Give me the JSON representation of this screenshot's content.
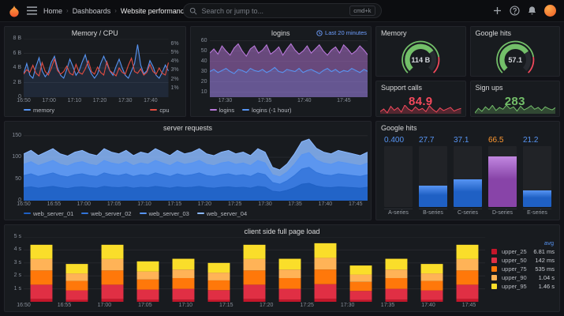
{
  "navbar": {
    "breadcrumb": [
      "Home",
      "Dashboards",
      "Website performance"
    ],
    "separator": "›",
    "search": {
      "placeholder": "Search or jump to...",
      "shortcut": "cmd+k"
    },
    "icons": {
      "logo": "grafana-flame",
      "menu": "hamburger",
      "search": "magnifier",
      "add": "plus",
      "help": "question-circle",
      "notifications": "bell",
      "profile": "user-avatar"
    }
  },
  "colors": {
    "page_bg": "#111217",
    "panel_bg": "#181b1f",
    "accent_orange": "#f05a28",
    "blue": "#5794f2",
    "red": "#f2495c",
    "green": "#73bf69",
    "purple": "#b877d9",
    "yellow": "#fade2a"
  },
  "panels": {
    "memory_cpu": {
      "title": "Memory / CPU"
    },
    "logins": {
      "title": "logins",
      "time_override": "Last 20 minutes"
    },
    "memory_gauge": {
      "title": "Memory",
      "value": "114 B",
      "fraction": 0.7,
      "color": "#73bf69",
      "threshold_color": "#f2495c",
      "threshold_frac": 0.8
    },
    "google_hits_gauge": {
      "title": "Google hits",
      "value": "57.1",
      "fraction": 0.71,
      "color": "#73bf69",
      "threshold_color": "#f2495c",
      "threshold_frac": 0.8
    },
    "support_calls": {
      "title": "Support calls",
      "value": "84.9",
      "color": "#f2495c",
      "spark": [
        60,
        70,
        55,
        80,
        65,
        75,
        58,
        85,
        70,
        62,
        78,
        66,
        72,
        60,
        82,
        68,
        58,
        74,
        64,
        70,
        76,
        62,
        68,
        72
      ]
    },
    "sign_ups": {
      "title": "Sign ups",
      "value": "283",
      "color": "#73bf69",
      "spark": [
        40,
        55,
        45,
        60,
        50,
        65,
        48,
        58,
        52,
        66,
        54,
        60,
        46,
        62,
        50,
        56,
        64,
        52,
        58,
        48,
        60,
        54,
        50,
        58
      ]
    },
    "server_requests": {
      "title": "server requests"
    },
    "google_hits_bars": {
      "title": "Google hits"
    },
    "page_load": {
      "title": "client side full page load"
    }
  },
  "chart_data": [
    {
      "id": "memory_cpu",
      "type": "line",
      "title": "Memory / CPU",
      "legend_pos": "split",
      "y_left": {
        "min": 0,
        "max": 8,
        "ticks": [
          {
            "v": 0,
            "l": "0"
          },
          {
            "v": 2,
            "l": "2 B"
          },
          {
            "v": 4,
            "l": "4 B"
          },
          {
            "v": 6,
            "l": "6 B"
          },
          {
            "v": 8,
            "l": "8 B"
          }
        ]
      },
      "y_right": {
        "min": 0,
        "max": 6.6,
        "ticks": [
          {
            "v": 1,
            "l": "1%"
          },
          {
            "v": 2,
            "l": "2%"
          },
          {
            "v": 3,
            "l": "3%"
          },
          {
            "v": 4,
            "l": "4%"
          },
          {
            "v": 5,
            "l": "5%"
          },
          {
            "v": 6,
            "l": "6%"
          }
        ]
      },
      "x_ticks": [
        {
          "f": 0,
          "l": "16:50"
        },
        {
          "f": 0.175,
          "l": "17:00"
        },
        {
          "f": 0.351,
          "l": "17:10"
        },
        {
          "f": 0.526,
          "l": "17:20"
        },
        {
          "f": 0.702,
          "l": "17:30"
        },
        {
          "f": 0.877,
          "l": "17:40"
        }
      ],
      "series": [
        {
          "name": "memory",
          "color": "#5794f2",
          "axis": "left",
          "fill": 0.12,
          "values": [
            3.2,
            4.6,
            3.0,
            2.6,
            4.2,
            5.4,
            3.6,
            2.8,
            3.4,
            4.8,
            5.6,
            4.0,
            3.0,
            2.6,
            3.8,
            5.2,
            4.2,
            3.0,
            3.6,
            4.8,
            5.8,
            4.2,
            3.2,
            2.6,
            3.2,
            4.6,
            5.6,
            4.6,
            3.6,
            3.0,
            4.2,
            5.2,
            4.0,
            3.0,
            2.6,
            3.6,
            4.6,
            7.2,
            4.4,
            3.2,
            3.6,
            5.0,
            4.2,
            3.0,
            2.6,
            3.4,
            4.4,
            3.6
          ]
        },
        {
          "name": "cpu",
          "color": "#e24d42",
          "axis": "right",
          "values": [
            2.6,
            3.1,
            2.8,
            3.6,
            2.7,
            2.4,
            3.9,
            2.9,
            2.5,
            3.3,
            4.3,
            3.0,
            2.6,
            2.9,
            3.5,
            2.7,
            2.5,
            3.7,
            2.8,
            2.6,
            3.2,
            4.1,
            2.9,
            2.6,
            3.4,
            2.8,
            2.5,
            4.0,
            3.0,
            2.7,
            2.4,
            3.3,
            2.8,
            2.6,
            3.6,
            4.4,
            2.9,
            2.7,
            3.2,
            2.5,
            2.8,
            3.7,
            2.9,
            2.6,
            3.3,
            2.7,
            2.5,
            3.9
          ]
        }
      ]
    },
    {
      "id": "logins",
      "type": "line",
      "title": "logins",
      "y_left": {
        "min": 5,
        "max": 62,
        "ticks": [
          {
            "v": 10,
            "l": "10"
          },
          {
            "v": 20,
            "l": "20"
          },
          {
            "v": 30,
            "l": "30"
          },
          {
            "v": 40,
            "l": "40"
          },
          {
            "v": 50,
            "l": "50"
          },
          {
            "v": 60,
            "l": "60"
          }
        ]
      },
      "x_ticks": [
        {
          "f": 0.1,
          "l": "17:30"
        },
        {
          "f": 0.35,
          "l": "17:35"
        },
        {
          "f": 0.6,
          "l": "17:40"
        },
        {
          "f": 0.85,
          "l": "17:45"
        }
      ],
      "series": [
        {
          "name": "logins",
          "color": "#b877d9",
          "fill": 0.5,
          "values": [
            48,
            52,
            47,
            55,
            50,
            46,
            53,
            57,
            50,
            45,
            52,
            55,
            48,
            51,
            56,
            47,
            50,
            54,
            46,
            52,
            57,
            51,
            47,
            50,
            55,
            48,
            52,
            56,
            50,
            46,
            51,
            54,
            48,
            56,
            52,
            47,
            50,
            55,
            51,
            46
          ]
        },
        {
          "name": "logins (-1 hour)",
          "color": "#5794f2",
          "fill": 0.18,
          "values": [
            30,
            32,
            29,
            31,
            33,
            30,
            28,
            32,
            31,
            29,
            33,
            31,
            30,
            32,
            29,
            31,
            34,
            30,
            29,
            32,
            31,
            30,
            33,
            29,
            31,
            32,
            30,
            28,
            31,
            33,
            30,
            32,
            29,
            31,
            30,
            33,
            31,
            29,
            32,
            30
          ]
        }
      ]
    },
    {
      "id": "server_requests",
      "type": "stacked-area",
      "title": "server requests",
      "y_left": {
        "min": 0,
        "max": 155,
        "ticks": [
          {
            "v": 0,
            "l": "0"
          },
          {
            "v": 50,
            "l": "50"
          },
          {
            "v": 100,
            "l": "100"
          },
          {
            "v": 150,
            "l": "150"
          }
        ]
      },
      "x_ticks": [
        {
          "f": 0,
          "l": "16:50"
        },
        {
          "f": 0.088,
          "l": "16:55"
        },
        {
          "f": 0.175,
          "l": "17:00"
        },
        {
          "f": 0.263,
          "l": "17:05"
        },
        {
          "f": 0.351,
          "l": "17:10"
        },
        {
          "f": 0.439,
          "l": "17:15"
        },
        {
          "f": 0.526,
          "l": "17:20"
        },
        {
          "f": 0.614,
          "l": "17:25"
        },
        {
          "f": 0.702,
          "l": "17:30"
        },
        {
          "f": 0.789,
          "l": "17:35"
        },
        {
          "f": 0.877,
          "l": "17:40"
        },
        {
          "f": 0.965,
          "l": "17:45"
        }
      ],
      "series": [
        {
          "name": "web_server_01",
          "color": "#1f60c4",
          "values": [
            30,
            32,
            29,
            31,
            33,
            30,
            28,
            31,
            32,
            30,
            29,
            33,
            31,
            30,
            32,
            29,
            31,
            30,
            33,
            31,
            29,
            32,
            30,
            31,
            33,
            30,
            29,
            31,
            32,
            30,
            31,
            29,
            33,
            31,
            22,
            20,
            24,
            30,
            38,
            40,
            34,
            31,
            30,
            32,
            31,
            30,
            29,
            31
          ]
        },
        {
          "name": "web_server_02",
          "color": "#3274d9",
          "values": [
            28,
            30,
            27,
            29,
            31,
            28,
            27,
            29,
            30,
            28,
            27,
            31,
            29,
            28,
            30,
            27,
            29,
            28,
            31,
            29,
            27,
            30,
            28,
            29,
            31,
            28,
            27,
            29,
            30,
            28,
            29,
            27,
            31,
            29,
            20,
            18,
            22,
            28,
            35,
            37,
            31,
            29,
            28,
            30,
            29,
            28,
            27,
            29
          ]
        },
        {
          "name": "web_server_03",
          "color": "#5794f2",
          "values": [
            26,
            28,
            25,
            27,
            29,
            26,
            25,
            27,
            28,
            26,
            25,
            29,
            27,
            26,
            28,
            25,
            27,
            26,
            29,
            27,
            25,
            28,
            26,
            27,
            29,
            26,
            25,
            27,
            28,
            26,
            27,
            25,
            29,
            27,
            18,
            17,
            20,
            26,
            33,
            34,
            29,
            27,
            26,
            28,
            27,
            26,
            25,
            27
          ]
        },
        {
          "name": "web_server_04",
          "color": "#8ab8ff",
          "values": [
            24,
            26,
            23,
            25,
            27,
            24,
            23,
            25,
            26,
            24,
            23,
            27,
            25,
            24,
            26,
            23,
            25,
            24,
            27,
            25,
            23,
            26,
            24,
            25,
            27,
            24,
            23,
            25,
            26,
            24,
            25,
            23,
            27,
            25,
            17,
            16,
            19,
            24,
            30,
            31,
            27,
            25,
            24,
            26,
            25,
            24,
            23,
            25
          ]
        }
      ]
    },
    {
      "id": "google_hits_bars",
      "type": "bargauge",
      "title": "Google hits",
      "max": 80,
      "bars": [
        {
          "label": "A-series",
          "value": "0.400",
          "frac": 0.006,
          "color": "#1f60c4",
          "color_top": "#5794f2",
          "value_color": "#5794f2"
        },
        {
          "label": "B-series",
          "value": "27.7",
          "frac": 0.35,
          "color": "#1f60c4",
          "color_top": "#5794f2",
          "value_color": "#5794f2"
        },
        {
          "label": "C-series",
          "value": "37.1",
          "frac": 0.46,
          "color": "#1f60c4",
          "color_top": "#5794f2",
          "value_color": "#5794f2"
        },
        {
          "label": "D-series",
          "value": "66.5",
          "frac": 0.83,
          "color": "#8844a8",
          "color_top": "#c187e0",
          "value_color": "#ff9830"
        },
        {
          "label": "E-series",
          "value": "21.2",
          "frac": 0.27,
          "color": "#1f60c4",
          "color_top": "#5794f2",
          "value_color": "#5794f2"
        }
      ]
    },
    {
      "id": "page_load",
      "type": "stacked-bar",
      "title": "client side full page load",
      "legend_pos": "right",
      "legend_header": "avg",
      "y_left": {
        "min": 0,
        "max": 5,
        "ticks": [
          {
            "v": 1,
            "l": "1 s"
          },
          {
            "v": 2,
            "l": "2 s"
          },
          {
            "v": 3,
            "l": "3 s"
          },
          {
            "v": 4,
            "l": "4 s"
          },
          {
            "v": 5,
            "l": "5 s"
          }
        ]
      },
      "x_ticks": [
        {
          "f": 0,
          "l": "16:50"
        },
        {
          "f": 0.088,
          "l": "16:55"
        },
        {
          "f": 0.175,
          "l": "17:00"
        },
        {
          "f": 0.263,
          "l": "17:05"
        },
        {
          "f": 0.351,
          "l": "17:10"
        },
        {
          "f": 0.439,
          "l": "17:15"
        },
        {
          "f": 0.526,
          "l": "17:20"
        },
        {
          "f": 0.614,
          "l": "17:25"
        },
        {
          "f": 0.702,
          "l": "17:30"
        },
        {
          "f": 0.789,
          "l": "17:35"
        },
        {
          "f": 0.877,
          "l": "17:40"
        },
        {
          "f": 0.965,
          "l": "17:45"
        }
      ],
      "series": [
        {
          "name": "upper_25",
          "avg": "6.81 ms",
          "color": "#c4162a",
          "values": [
            0.22,
            0.15,
            0.22,
            0.16,
            0.17,
            0.15,
            0.22,
            0.17,
            0.23,
            0.14,
            0.17,
            0.15,
            0.22
          ]
        },
        {
          "name": "upper_50",
          "avg": "142 ms",
          "color": "#e02f44",
          "values": [
            1.1,
            0.73,
            1.1,
            0.78,
            0.83,
            0.75,
            1.1,
            0.83,
            1.13,
            0.7,
            0.83,
            0.73,
            1.1
          ]
        },
        {
          "name": "upper_75",
          "avg": "535 ms",
          "color": "#ff780a",
          "values": [
            1.1,
            0.73,
            1.1,
            0.78,
            0.83,
            0.75,
            1.1,
            0.83,
            1.13,
            0.7,
            0.83,
            0.73,
            1.1
          ]
        },
        {
          "name": "upper_90",
          "avg": "1.04 s",
          "color": "#ffb357",
          "values": [
            0.88,
            0.58,
            0.88,
            0.62,
            0.66,
            0.6,
            0.88,
            0.66,
            0.9,
            0.56,
            0.66,
            0.58,
            0.88
          ]
        },
        {
          "name": "upper_95",
          "avg": "1.46 s",
          "color": "#fade2a",
          "values": [
            1.1,
            0.73,
            1.1,
            0.78,
            0.83,
            0.75,
            1.1,
            0.83,
            1.13,
            0.7,
            0.83,
            0.73,
            1.1
          ]
        }
      ]
    }
  ]
}
